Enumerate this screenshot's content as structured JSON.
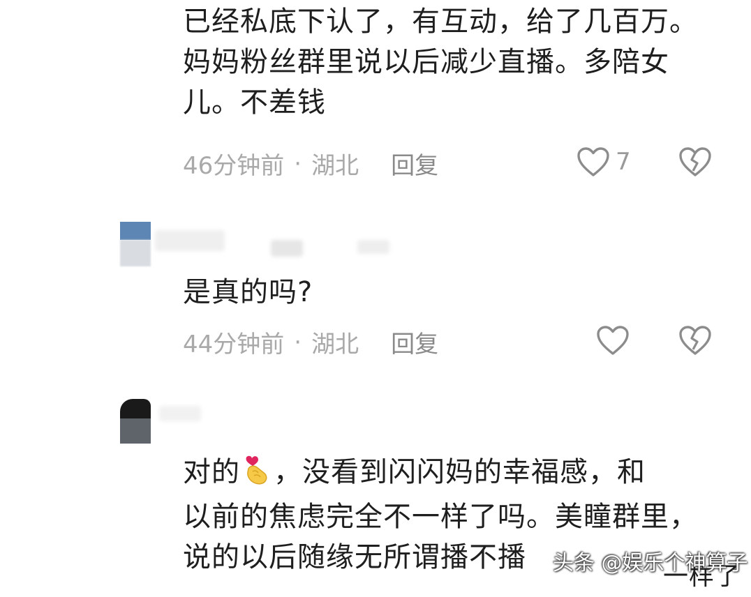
{
  "comments": [
    {
      "lines": [
        "已经私底下认了，有互动，给了几百万。",
        "妈妈粉丝群里说以后减少直播。多陪女",
        "儿。不差钱"
      ],
      "time": "46分钟前",
      "location": "湖北",
      "reply_label": "回复",
      "like_count": "7"
    },
    {
      "lines": [
        "是真的吗?"
      ],
      "time": "44分钟前",
      "location": "湖北",
      "reply_label": "回复"
    },
    {
      "lines": [
        "对的",
        "，没看到闪闪妈的幸福感，和",
        "以前的焦虑完全不一样了吗。美瞳群里，",
        "说的以后随缘无所谓播不播",
        "一样了"
      ]
    }
  ],
  "separator": "·",
  "watermark": "头条 @娱乐个神算子",
  "icons": {
    "like": "heart-outline-icon",
    "dislike": "broken-heart-icon",
    "emoji": "finger-heart-emoji-icon"
  },
  "colors": {
    "text": "#1e1e1e",
    "meta": "#a9a9a9",
    "icon": "#8c8c8c"
  }
}
